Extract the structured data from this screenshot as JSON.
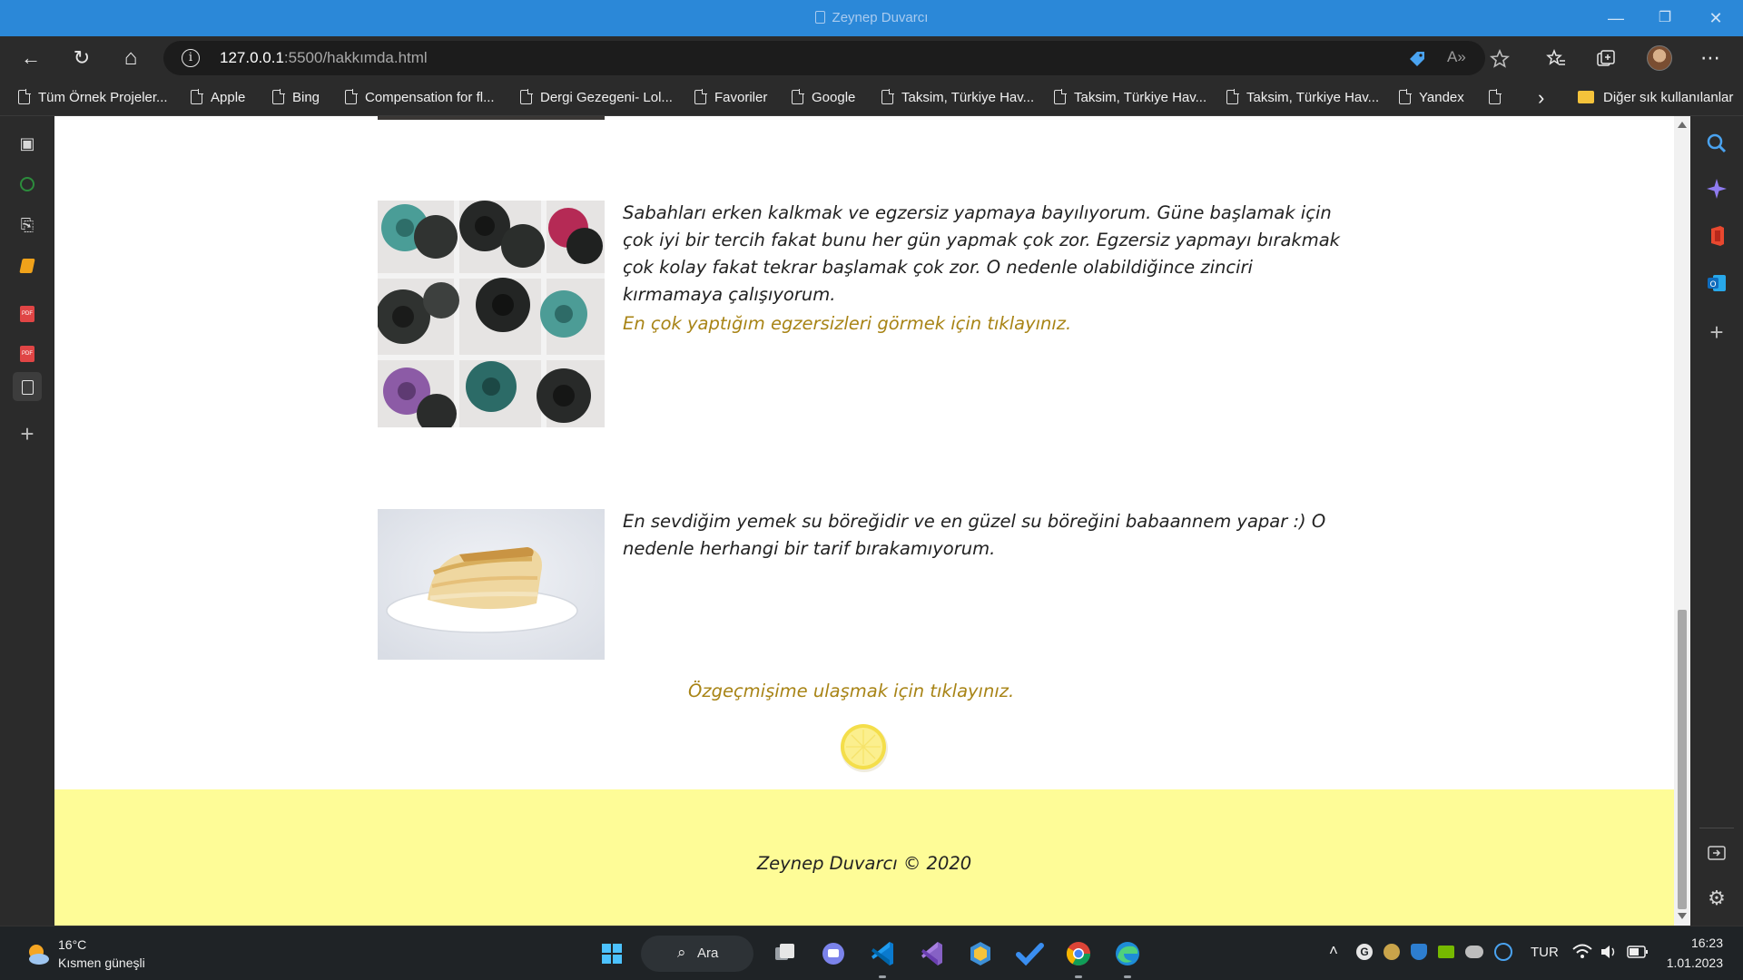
{
  "window": {
    "title": "Zeynep Duvarcı",
    "minimize_glyph": "—",
    "maximize_glyph": "❐",
    "close_glyph": "✕"
  },
  "toolbar": {
    "url_host": "127.0.0.1",
    "url_rest": ":5500/hakkımda.html",
    "info_glyph": "i",
    "back_glyph": "←",
    "refresh_glyph": "↻",
    "home_glyph": "⌂",
    "read_aloud_glyph": "A»",
    "more_glyph": "⋯"
  },
  "bookmarks": {
    "items": [
      {
        "label": "Tüm Örnek Projeler..."
      },
      {
        "label": "Apple"
      },
      {
        "label": "Bing"
      },
      {
        "label": "Compensation for fl..."
      },
      {
        "label": "Dergi Gezegeni- Lol..."
      },
      {
        "label": "Favoriler"
      },
      {
        "label": "Google"
      },
      {
        "label": "Taksim, Türkiye Hav..."
      },
      {
        "label": "Taksim, Türkiye Hav..."
      },
      {
        "label": "Taksim, Türkiye Hav..."
      },
      {
        "label": "Yandex"
      },
      {
        "label": ""
      }
    ],
    "overflow_glyph": "›",
    "other_folder": "Diğer sık kullanılanlar"
  },
  "page": {
    "exercise_text": "Sabahları erken kalkmak ve egzersiz yapmaya bayılıyorum. Güne başlamak için çok iyi bir tercih fakat bunu her gün yapmak çok zor. Egzersiz yapmayı bırakmak çok kolay fakat tekrar başlamak çok zor. O nedenle olabildiğince zinciri kırmamaya çalışıyorum.",
    "exercise_link": "En çok yaptığım egzersizleri görmek için tıklayınız.",
    "food_text": "En sevdiğim yemek su böreğidir ve en güzel su böreğini babaannem yapar :) O nedenle herhangi bir tarif bırakamıyorum.",
    "cv_link": "Özgeçmişime ulaşmak için tıklayınız.",
    "footer": "Zeynep Duvarcı © 2020",
    "colors": {
      "link": "#a88416",
      "footer_bg": "#fefc97",
      "titlebar": "#2b88d8"
    }
  },
  "taskbar": {
    "weather_temp": "16°C",
    "weather_desc": "Kısmen güneşli",
    "search_label": "Ara",
    "lang": "TUR",
    "time": "16:23",
    "date": "1.01.2023"
  }
}
